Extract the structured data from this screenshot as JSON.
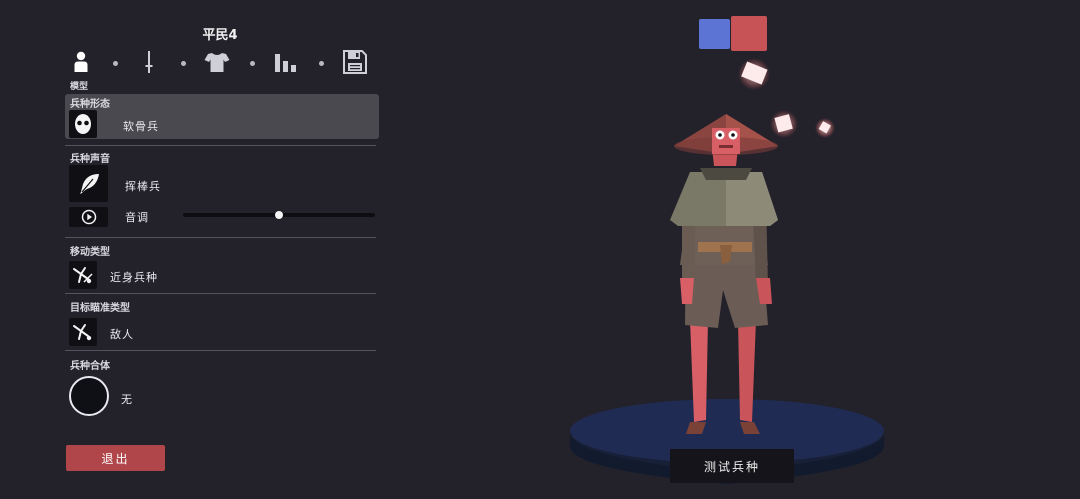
{
  "unit": {
    "name": "平民4"
  },
  "tabs": [
    {
      "icon": "person-icon",
      "label": "模型"
    },
    {
      "icon": "sword-icon"
    },
    {
      "icon": "shirt-icon"
    },
    {
      "icon": "bar-chart-icon"
    },
    {
      "icon": "save-icon"
    }
  ],
  "sections": {
    "unit_form": {
      "label": "兵种形态",
      "value": "软骨兵",
      "icon": "mask-icon"
    },
    "unit_sound": {
      "label": "兵种声音",
      "value": "挥棒兵",
      "icon": "feather-icon"
    },
    "pitch": {
      "label": "音调",
      "icon": "play-icon",
      "level": 0.5
    },
    "movement": {
      "label": "移动类型",
      "value": "近身兵种",
      "icon": "melee-icon"
    },
    "targeting": {
      "label": "目标瞄准类型",
      "value": "敌人",
      "icon": "target-melee-icon"
    },
    "fusion": {
      "label": "兵种合体",
      "value": "无"
    }
  },
  "buttons": {
    "exit": "退出",
    "test": "测试兵种"
  },
  "colors": {
    "team_blue": "#5c74d3",
    "team_red": "#c75356",
    "exit_button": "#b1464a",
    "background": "#23222b"
  }
}
